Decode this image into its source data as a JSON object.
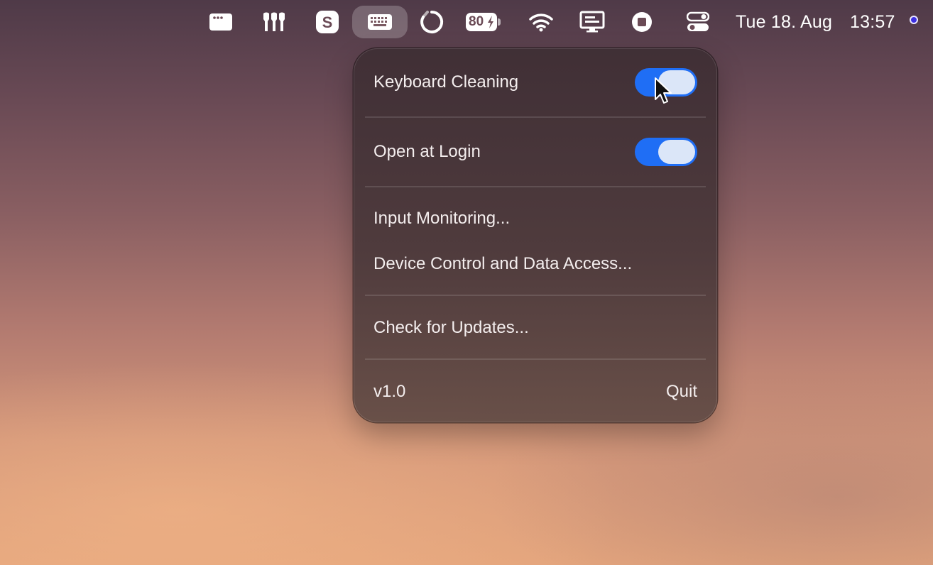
{
  "menubar": {
    "icons": [
      "window-icon",
      "bartender-icon",
      "skype-icon",
      "keyboard-icon",
      "sync-icon",
      "battery-icon",
      "wifi-icon",
      "display-icon",
      "record-icon",
      "control-center-icon"
    ],
    "battery_percent": "80",
    "date": "Tue 18. Aug",
    "time": "13:57",
    "siri_dot_color": "#3d2fe0"
  },
  "menu": {
    "keyboard_cleaning": {
      "label": "Keyboard Cleaning",
      "enabled": true
    },
    "open_at_login": {
      "label": "Open at Login",
      "enabled": true
    },
    "input_monitoring": "Input Monitoring...",
    "device_control": "Device Control and Data Access...",
    "check_updates": "Check for Updates...",
    "version": "v1.0",
    "quit": "Quit"
  },
  "colors": {
    "toggle_on": "#1f6ef5",
    "knob": "#dbe6f8"
  }
}
